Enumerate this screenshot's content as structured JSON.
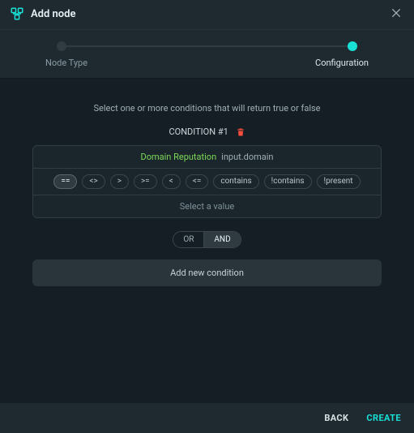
{
  "header": {
    "title": "Add node"
  },
  "stepper": {
    "steps": [
      "Node Type",
      "Configuration"
    ],
    "active_index": 1
  },
  "help_text": "Select one or more conditions that will return true or false",
  "condition": {
    "label": "CONDITION  #1",
    "action_name": "Domain Reputation",
    "field": "input.domain",
    "operators": [
      "==",
      "<>",
      ">",
      ">=",
      "<",
      "<=",
      "contains",
      "!contains",
      "!present"
    ],
    "selected_operator": "==",
    "value_placeholder": "Select a value"
  },
  "joiner": {
    "options": [
      "OR",
      "AND"
    ],
    "selected": "AND"
  },
  "add_condition_label": "Add new condition",
  "footer": {
    "back": "BACK",
    "create": "CREATE"
  }
}
